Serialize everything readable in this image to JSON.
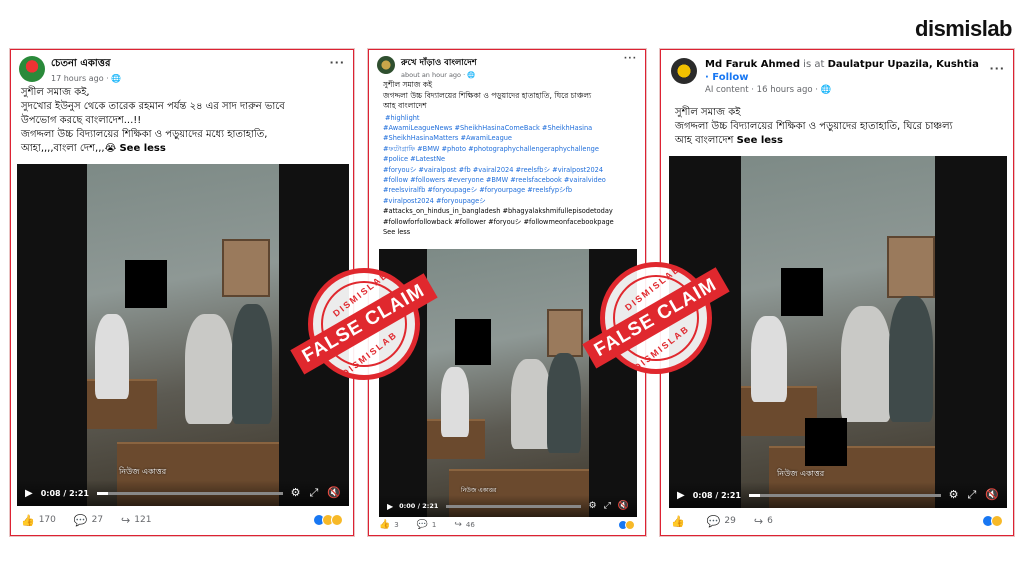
{
  "brand": {
    "logo": "dismislab"
  },
  "posts": [
    {
      "page_name": "চেতনা একাত্তর",
      "time": "17 hours ago · ",
      "body": [
        "সুশীল সমাজ কই,",
        "সুদখোর ইউনুস থেকে তারেক রহমান পর্যন্ত ২৪ এর সাদ দারুন ভাবে",
        "উপভোগ করছে বাংলাদেশ...!!",
        "জগদ্দলা উচ্চ বিদ্যালয়ের শিক্ষিকা ও পড়ুয়াদের মধ্যে হাতাহাতি,",
        "আহা,,,,বাংলা দেশ,,,😭 "
      ],
      "see_less": "See less",
      "video_watermark": "নিউজ একাত্তর",
      "time_display": "0:08 / 2:21",
      "reactions": "170",
      "comments": "27",
      "shares": "121"
    },
    {
      "page_name": "রুখে দাঁড়াও বাংলাদেশ",
      "time": "about an hour ago · ",
      "body": [
        "সুশীল সমাজ কই",
        "জগদ্দলা উচ্চ বিদ্যালয়ের শিক্ষিকা ও পড়ুয়াদের হাতাহাতি, ঘিরে চাঞ্চল্য",
        "আহ বাংলাদেশ"
      ],
      "hashtags": [
        "#highlight",
        "#AwamiLeagueNews #SheikhHasinaComeBack #SheikhHasina",
        "#SheikhHasinaMatters #AwamiLeague",
        "#ফটোগ্রাফি #BMW #photo #photographychallengeraphychallenge",
        "#police #LatestNe",
        "#foryouシ #vairalpost #fb #vairal2024 #reelsfbシ #viralpost2024",
        "#follow #followers #everyone #BMW #reelsfacebook #vairalvideo",
        "#reelsviralfb #foryoupageシ #foryourpage #reelsfypシfb",
        "#viralpost2024 #foryoupageシ",
        "#attacks_on_hindus_in_bangladesh #bhagyalakshmifullepisodetoday",
        "#followforfollowback #follower #foryouシ #followmeonfacebookpage"
      ],
      "see_less": "See less",
      "video_watermark": "নিউজ একাত্তর",
      "time_display": "0:00 / 2:21",
      "reactions": "3",
      "comments": "1",
      "shares": "46"
    },
    {
      "page_name": "Md Faruk Ahmed",
      "is_at": " is at ",
      "location": "Daulatpur Upazila, Kushtia",
      "follow": "· Follow",
      "time": "AI content · 16 hours ago · ",
      "body": [
        "সুশীল সমাজ কই",
        "জগদ্দলা উচ্চ বিদ্যালয়ের শিক্ষিকা ও পড়ুয়াদের হাতাহাতি, ঘিরে চাঞ্চল্য",
        "আহ বাংলাদেশ "
      ],
      "see_less": "See less",
      "video_watermark": "নিউজ একাত্তর",
      "time_display": "0:08 / 2:21",
      "reactions": "",
      "comments": "29",
      "shares": "6"
    }
  ],
  "stamp": {
    "label": "FALSE CLAIM",
    "arc_top": "DISMISLAB",
    "arc_bottom": "DISMISLAB"
  },
  "colors": {
    "stamp_red": "#e0282e",
    "link_blue": "#216fdb",
    "like_blue": "#1877f2",
    "reaction_yellow": "#f7b928"
  }
}
